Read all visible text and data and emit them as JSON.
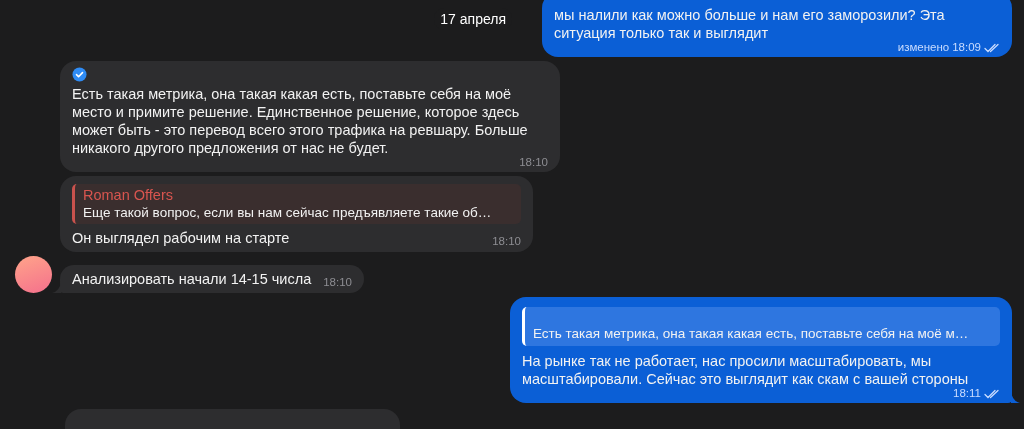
{
  "date_badge": "17 апреля",
  "messages": [
    {
      "kind": "outgoing",
      "text": "мы налили как можно больше и нам его заморозили? Эта ситуация только так и выглядит",
      "edited_label": "изменено",
      "time": "18:09",
      "read": true,
      "tail": false
    },
    {
      "kind": "incoming",
      "verified": true,
      "text": "Есть такая метрика, она такая какая есть, поставьте себя на моё место и примите решение. Единственное решение, которое здесь может быть - это перевод всего этого трафика на ревшару. Больше никакого другого предложения от нас не будет.",
      "time": "18:10",
      "avatar": false,
      "tail": false
    },
    {
      "kind": "incoming",
      "reply": {
        "author": "Roman Offers",
        "text": "Еще такой вопрос, если вы нам сейчас предъявляете такие об…"
      },
      "text": "Он выглядел рабочим на старте",
      "time": "18:10",
      "avatar": false,
      "tail": false
    },
    {
      "kind": "incoming",
      "text": "Анализировать начали 14-15 числа",
      "time": "18:10",
      "avatar": true,
      "tail": true
    },
    {
      "kind": "outgoing",
      "reply": {
        "text": "Есть такая метрика, она такая какая есть, поставьте себя на моё м…"
      },
      "text": "На рынке так не работает, нас просили масштабировать, мы масштабировали. Сейчас это выглядит как скам с вашей стороны",
      "time": "18:11",
      "read": true,
      "tail": true
    },
    {
      "kind": "partial"
    }
  ]
}
